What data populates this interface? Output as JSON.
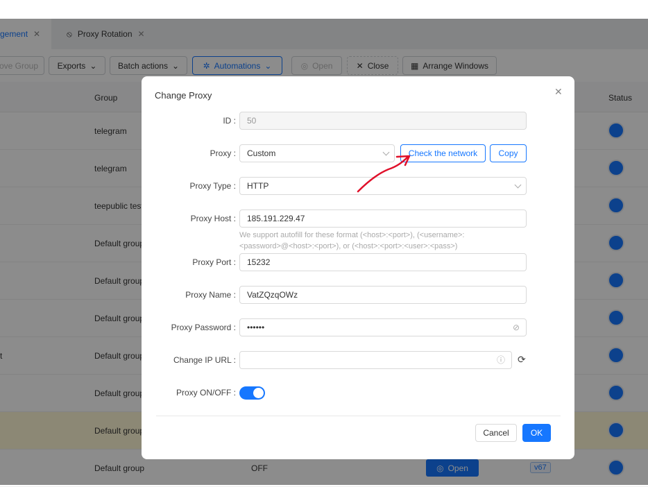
{
  "tabs": [
    {
      "label": "gement",
      "active": true
    },
    {
      "label": "Proxy Rotation",
      "active": false
    }
  ],
  "toolbar": {
    "move_group": "ove Group",
    "exports": "Exports",
    "batch": "Batch actions",
    "automations": "Automations",
    "open": "Open",
    "close": "Close",
    "arrange": "Arrange Windows"
  },
  "table": {
    "headers": {
      "group": "Group",
      "status": "Status"
    },
    "rows": [
      {
        "name": "",
        "group": "telegram"
      },
      {
        "name": "",
        "group": "telegram"
      },
      {
        "name": "",
        "group": "teepublic test"
      },
      {
        "name": "",
        "group": "Default group"
      },
      {
        "name": "",
        "group": "Default group"
      },
      {
        "name": "",
        "group": "Default group"
      },
      {
        "name": "t",
        "group": "Default group"
      },
      {
        "name": "",
        "group": "Default group"
      },
      {
        "name": "",
        "group": "Default group"
      },
      {
        "name": "",
        "group": "Default group",
        "proxy": "OFF",
        "open": "Open",
        "version": "v67"
      }
    ]
  },
  "dialog": {
    "title": "Change Proxy",
    "id_label": "ID",
    "id_value": "50",
    "proxy_label": "Proxy",
    "proxy_value": "Custom",
    "check_network": "Check the network",
    "copy": "Copy",
    "type_label": "Proxy Type",
    "type_value": "HTTP",
    "host_label": "Proxy Host",
    "host_value": "185.191.229.47",
    "host_hint_1": "We support autofill for these format (<host>:<port>), (<username>:",
    "host_hint_2": "<password>@<host>:<port>), or (<host>:<port>:<user>:<pass>)",
    "port_label": "Proxy Port",
    "port_value": "15232",
    "name_label": "Proxy Name",
    "name_value": "VatZQzqOWz",
    "password_label": "Proxy Password",
    "password_value": "••••••",
    "change_ip_label": "Change IP URL",
    "change_ip_value": "",
    "toggle_label": "Proxy ON/OFF",
    "toggle_on": true,
    "cancel": "Cancel",
    "ok": "OK"
  },
  "colors": {
    "accent": "#1677ff",
    "annotation": "#e0102a"
  }
}
